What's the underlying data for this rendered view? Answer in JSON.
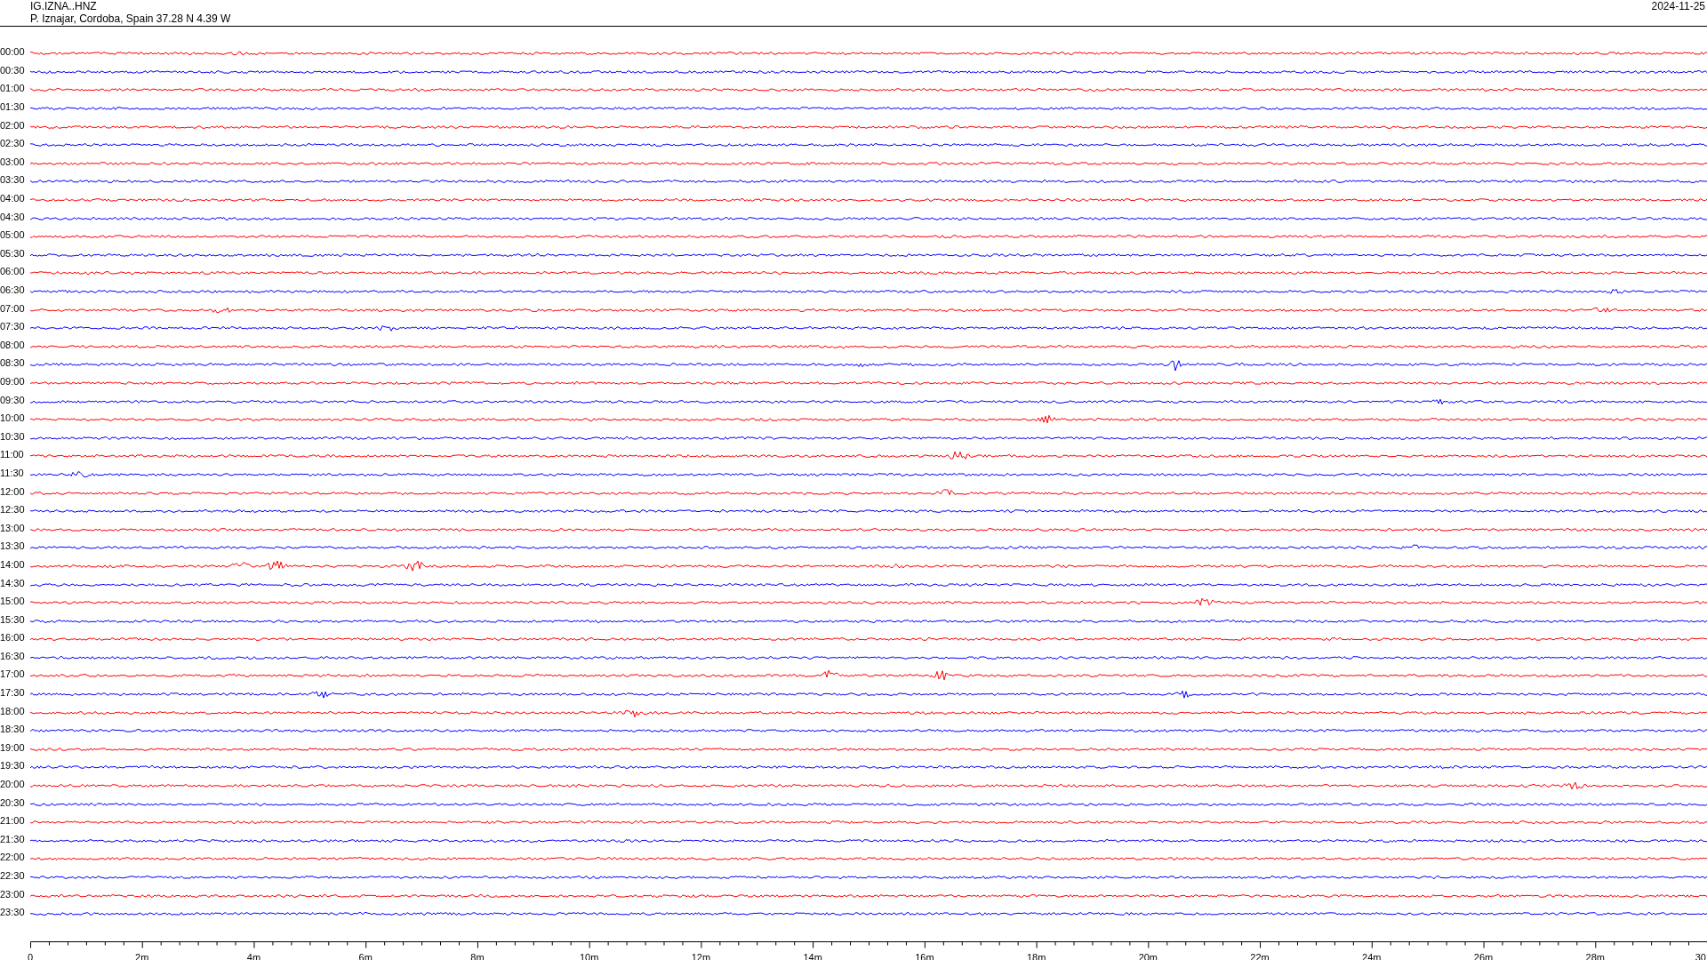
{
  "header": {
    "station": "IG.IZNA..HNZ",
    "location": "P. Iznajar, Cordoba, Spain  37.28 N 4.39 W",
    "date": "2024-11-25"
  },
  "traces": [
    {
      "label": "00:00",
      "color": "#ff0000"
    },
    {
      "label": "00:30",
      "color": "#0000ff"
    },
    {
      "label": "01:00",
      "color": "#ff0000"
    },
    {
      "label": "01:30",
      "color": "#0000ff"
    },
    {
      "label": "02:00",
      "color": "#ff0000"
    },
    {
      "label": "02:30",
      "color": "#0000ff"
    },
    {
      "label": "03:00",
      "color": "#ff0000"
    },
    {
      "label": "03:30",
      "color": "#0000ff"
    },
    {
      "label": "04:00",
      "color": "#ff0000"
    },
    {
      "label": "04:30",
      "color": "#0000ff"
    },
    {
      "label": "05:00",
      "color": "#ff0000"
    },
    {
      "label": "05:30",
      "color": "#0000ff"
    },
    {
      "label": "06:00",
      "color": "#ff0000"
    },
    {
      "label": "06:30",
      "color": "#0000ff"
    },
    {
      "label": "07:00",
      "color": "#ff0000"
    },
    {
      "label": "07:30",
      "color": "#0000ff"
    },
    {
      "label": "08:00",
      "color": "#ff0000"
    },
    {
      "label": "08:30",
      "color": "#0000ff"
    },
    {
      "label": "09:00",
      "color": "#ff0000"
    },
    {
      "label": "09:30",
      "color": "#0000ff"
    },
    {
      "label": "10:00",
      "color": "#ff0000"
    },
    {
      "label": "10:30",
      "color": "#0000ff"
    },
    {
      "label": "11:00",
      "color": "#ff0000"
    },
    {
      "label": "11:30",
      "color": "#0000ff"
    },
    {
      "label": "12:00",
      "color": "#ff0000"
    },
    {
      "label": "12:30",
      "color": "#0000ff"
    },
    {
      "label": "13:00",
      "color": "#ff0000"
    },
    {
      "label": "13:30",
      "color": "#0000ff"
    },
    {
      "label": "14:00",
      "color": "#ff0000"
    },
    {
      "label": "14:30",
      "color": "#0000ff"
    },
    {
      "label": "15:00",
      "color": "#ff0000"
    },
    {
      "label": "15:30",
      "color": "#0000ff"
    },
    {
      "label": "16:00",
      "color": "#ff0000"
    },
    {
      "label": "16:30",
      "color": "#0000ff"
    },
    {
      "label": "17:00",
      "color": "#ff0000"
    },
    {
      "label": "17:30",
      "color": "#0000ff"
    },
    {
      "label": "18:00",
      "color": "#ff0000"
    },
    {
      "label": "18:30",
      "color": "#0000ff"
    },
    {
      "label": "19:00",
      "color": "#ff0000"
    },
    {
      "label": "19:30",
      "color": "#0000ff"
    },
    {
      "label": "20:00",
      "color": "#ff0000"
    },
    {
      "label": "20:30",
      "color": "#0000ff"
    },
    {
      "label": "21:00",
      "color": "#ff0000"
    },
    {
      "label": "21:30",
      "color": "#0000ff"
    },
    {
      "label": "22:00",
      "color": "#ff0000"
    },
    {
      "label": "22:30",
      "color": "#0000ff"
    },
    {
      "label": "23:00",
      "color": "#ff0000"
    },
    {
      "label": "23:30",
      "color": "#0000ff"
    }
  ],
  "x_axis": {
    "labels": [
      "0",
      "2m",
      "4m",
      "6m",
      "8m",
      "10m",
      "12m",
      "14m",
      "16m",
      "18m",
      "20m",
      "22m",
      "24m",
      "26m",
      "28m",
      "30"
    ]
  }
}
